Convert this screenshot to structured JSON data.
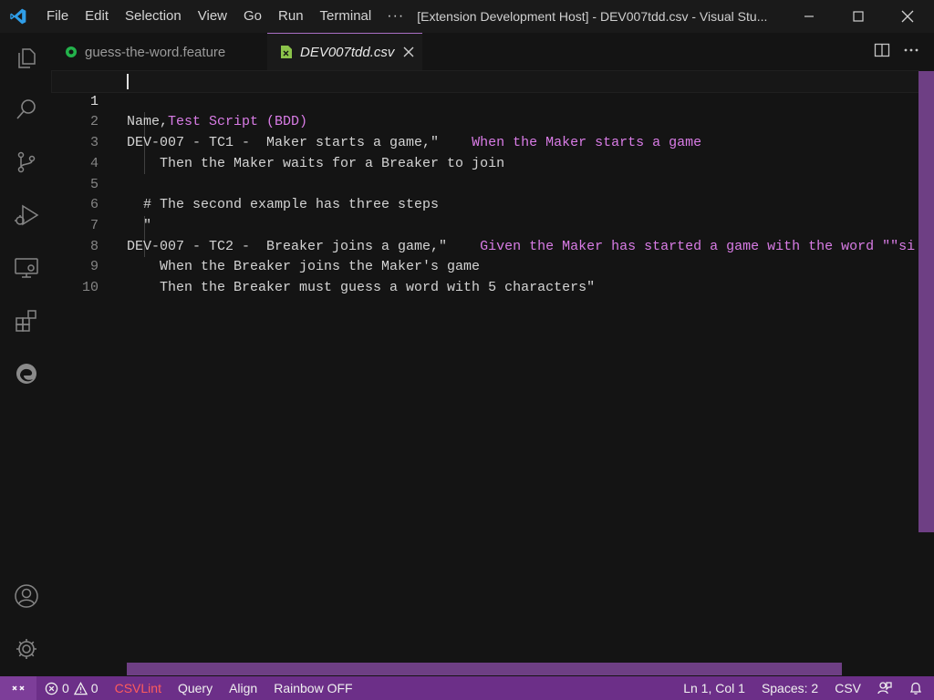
{
  "titlebar": {
    "menu": [
      "File",
      "Edit",
      "Selection",
      "View",
      "Go",
      "Run",
      "Terminal"
    ],
    "more": "···",
    "window_title": "[Extension Development Host] - DEV007tdd.csv - Visual Stu..."
  },
  "tabs": [
    {
      "label": "guess-the-word.feature",
      "icon": "cucumber-icon",
      "active": false
    },
    {
      "label": "DEV007tdd.csv",
      "icon": "csv-file-icon",
      "active": true
    }
  ],
  "editor": {
    "lines": [
      {
        "num": "1",
        "seg1": "Name,",
        "seg2": "Test Script (BDD)"
      },
      {
        "num": "2",
        "seg1": "DEV-007 - TC1 -  Maker starts a game,\"",
        "seg2": "    When the Maker starts a game"
      },
      {
        "num": "3",
        "seg1": "    Then the Maker waits for a Breaker to join",
        "seg2": ""
      },
      {
        "num": "4",
        "seg1": "",
        "seg2": ""
      },
      {
        "num": "5",
        "seg1": "  # The second example has three steps",
        "seg2": ""
      },
      {
        "num": "6",
        "seg1": "  \"",
        "seg2": ""
      },
      {
        "num": "7",
        "seg1": "DEV-007 - TC2 -  Breaker joins a game,\"",
        "seg2": "    Given the Maker has started a game with the word \"\"si"
      },
      {
        "num": "8",
        "seg1": "    When the Breaker joins the Maker's game",
        "seg2": ""
      },
      {
        "num": "9",
        "seg1": "    Then the Breaker must guess a word with 5 characters\"",
        "seg2": ""
      },
      {
        "num": "10",
        "seg1": "",
        "seg2": ""
      }
    ],
    "colors": {
      "column1": "#d4d4d4",
      "column2": "#d97ce6"
    }
  },
  "statusbar": {
    "errors": "0",
    "warnings": "0",
    "csvlint": "CSVLint",
    "query": "Query",
    "align": "Align",
    "rainbow": "Rainbow OFF",
    "position": "Ln 1, Col 1",
    "spaces": "Spaces: 2",
    "language": "CSV"
  },
  "theme": {
    "accent": "#6c2f88",
    "csvlint_color": "#ff5c5c"
  }
}
